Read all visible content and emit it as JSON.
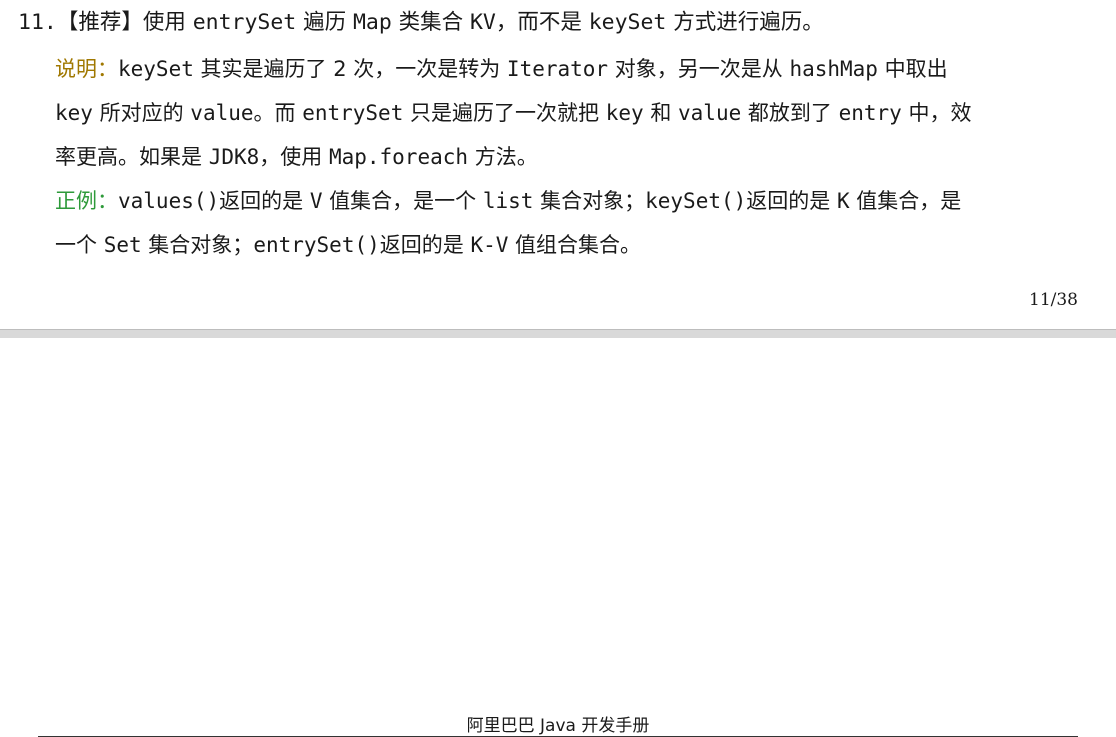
{
  "rule": {
    "number": "11.",
    "tag": "【推荐】",
    "text_a": "使用 ",
    "code_a": "entrySet",
    "text_b": " 遍历 ",
    "code_b": "Map",
    "text_c": " 类集合 ",
    "code_c": "KV",
    "text_d": "，而不是 ",
    "code_d": "keySet",
    "text_e": " 方式进行遍历。"
  },
  "note": {
    "label": "说明：",
    "l2_code1": "keySet",
    "l2_t1": " 其实是遍历了 2 次，一次是转为 ",
    "l2_code2": "Iterator",
    "l2_t2": " 对象，另一次是从 ",
    "l2_code3": "hashMap",
    "l2_t3": " 中取出",
    "l3_code1": "key",
    "l3_t1": " 所对应的 ",
    "l3_code2": "value",
    "l3_t2": "。而 ",
    "l3_code3": "entrySet",
    "l3_t3": " 只是遍历了一次就把 ",
    "l3_code4": "key",
    "l3_t4": " 和 ",
    "l3_code5": "value",
    "l3_t5": " 都放到了 ",
    "l3_code6": "entry",
    "l3_t6": " 中，效",
    "l4_t1": "率更高。如果是 ",
    "l4_code1": "JDK8",
    "l4_t2": "，使用 ",
    "l4_code2": "Map.foreach",
    "l4_t3": " 方法。"
  },
  "example": {
    "label": "正例：",
    "l5_code1": "values()",
    "l5_t1": "返回的是 ",
    "l5_code2": "V",
    "l5_t2": " 值集合，是一个 ",
    "l5_code3": "list",
    "l5_t3": " 集合对象；",
    "l5_code4": "keySet()",
    "l5_t4": "返回的是 ",
    "l5_code5": "K",
    "l5_t5": " 值集合，是",
    "l6_t1": "一个 ",
    "l6_code1": "Set",
    "l6_t2": " 集合对象；",
    "l6_code2": "entrySet()",
    "l6_t3": "返回的是 ",
    "l6_code3": "K-V",
    "l6_t4": " 值组合集合。"
  },
  "footer": {
    "page_number": "11/38"
  },
  "next_page": {
    "header_title": "阿里巴巴 Java 开发手册"
  }
}
